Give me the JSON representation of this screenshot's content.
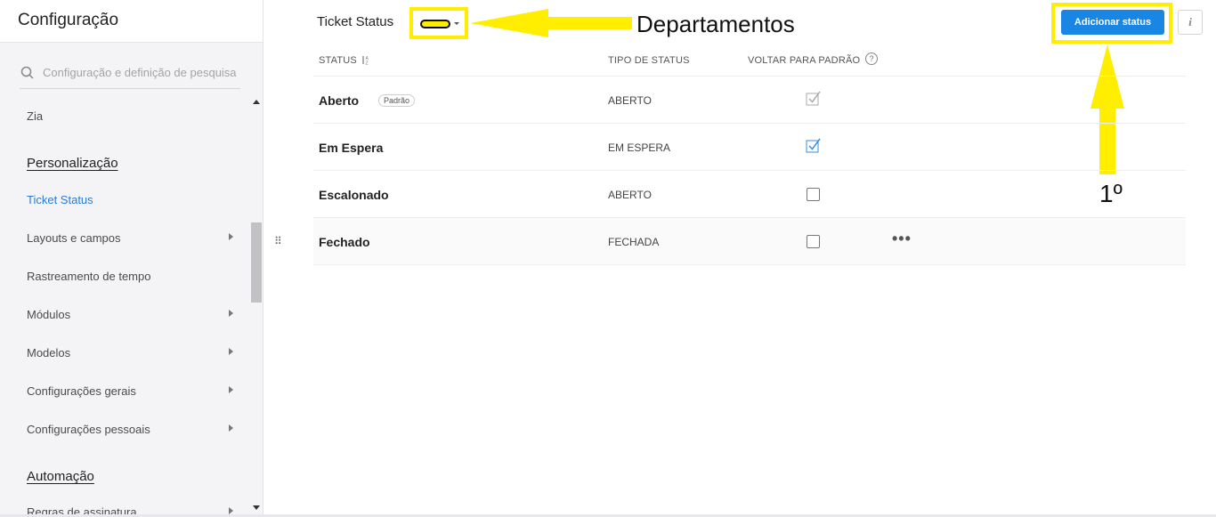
{
  "sidebar": {
    "title": "Configuração",
    "search_placeholder": "Configuração e definição de pesquisa",
    "items": [
      {
        "label": "Zia",
        "type": "item"
      },
      {
        "label": "Personalização",
        "type": "section"
      },
      {
        "label": "Ticket Status",
        "type": "item",
        "active": true
      },
      {
        "label": "Layouts e campos",
        "type": "item",
        "submenu": true
      },
      {
        "label": "Rastreamento de tempo",
        "type": "item"
      },
      {
        "label": "Módulos",
        "type": "item",
        "submenu": true
      },
      {
        "label": "Modelos",
        "type": "item",
        "submenu": true
      },
      {
        "label": "Configurações gerais",
        "type": "item",
        "submenu": true
      },
      {
        "label": "Configurações pessoais",
        "type": "item",
        "submenu": true
      },
      {
        "label": "Automação",
        "type": "section"
      },
      {
        "label": "Regras de assinatura",
        "type": "item",
        "submenu": true
      }
    ]
  },
  "header": {
    "title": "Ticket Status",
    "add_button": "Adicionar status",
    "info_icon": "i"
  },
  "annotations": {
    "departments_label": "Departamentos",
    "order_label": "1º",
    "highlight_color": "#ffee00"
  },
  "table": {
    "columns": [
      "STATUS",
      "TIPO DE STATUS",
      "VOLTAR PARA PADRÃO"
    ],
    "help_icon": "?",
    "default_badge": "Padrão",
    "rows": [
      {
        "name": "Aberto",
        "type": "ABERTO",
        "default": true,
        "check": "check-gray"
      },
      {
        "name": "Em Espera",
        "type": "EM ESPERA",
        "default": false,
        "check": "check-blue"
      },
      {
        "name": "Escalonado",
        "type": "ABERTO",
        "default": false,
        "check": "unchecked"
      },
      {
        "name": "Fechado",
        "type": "FECHADA",
        "default": false,
        "check": "unchecked"
      }
    ]
  },
  "colors": {
    "accent": "#1a86e3",
    "active_link": "#2c7ad6"
  }
}
